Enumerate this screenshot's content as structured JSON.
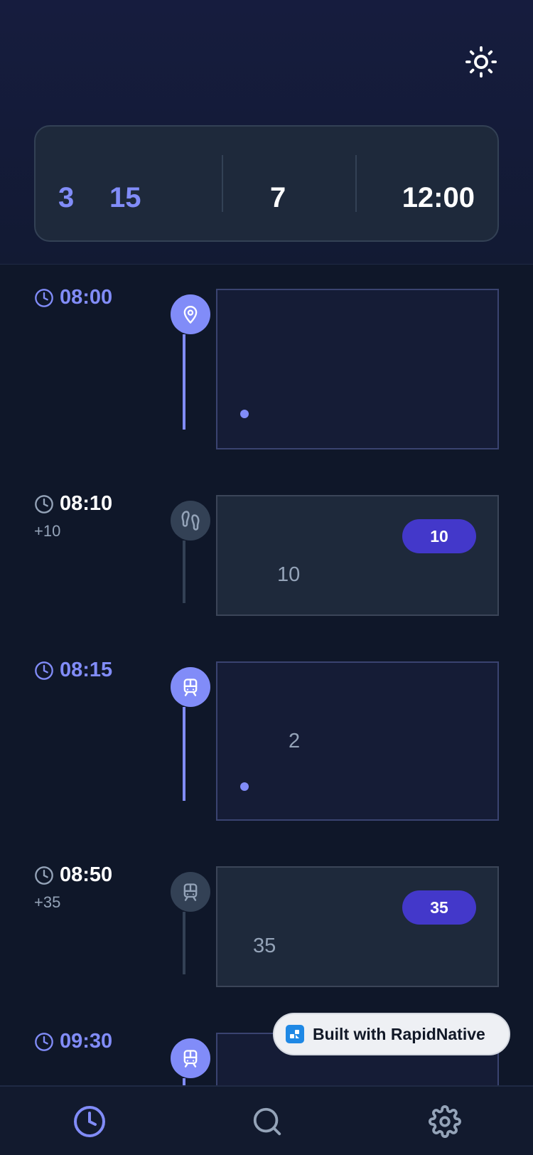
{
  "summary": {
    "first_value": "3",
    "second_value": "15",
    "middle_value": "7",
    "end_time": "12:00"
  },
  "stops": [
    {
      "time": "08:00",
      "delta": "",
      "icon": "map-pin-icon",
      "card_text": "",
      "badge": "",
      "active": true
    },
    {
      "time": "08:10",
      "delta": "+10",
      "icon": "footprints-icon",
      "card_text": "10",
      "badge": "10",
      "active": false
    },
    {
      "time": "08:15",
      "delta": "",
      "icon": "train-icon",
      "card_text": "2",
      "badge": "",
      "active": true
    },
    {
      "time": "08:50",
      "delta": "+35",
      "icon": "train-icon",
      "card_text": "35",
      "badge": "35",
      "active": false
    },
    {
      "time": "09:30",
      "delta": "",
      "icon": "train-icon",
      "card_text": "",
      "badge": "",
      "active": true
    }
  ],
  "built_badge": {
    "label": "Built with RapidNative"
  },
  "tabs": [
    {
      "name": "clock-icon",
      "active": true
    },
    {
      "name": "search-icon",
      "active": false
    },
    {
      "name": "gear-icon",
      "active": false
    }
  ],
  "colors": {
    "accent": "#818cf8",
    "badge": "#4338ca",
    "background": "#0f1729",
    "muted": "#94a3b8"
  }
}
